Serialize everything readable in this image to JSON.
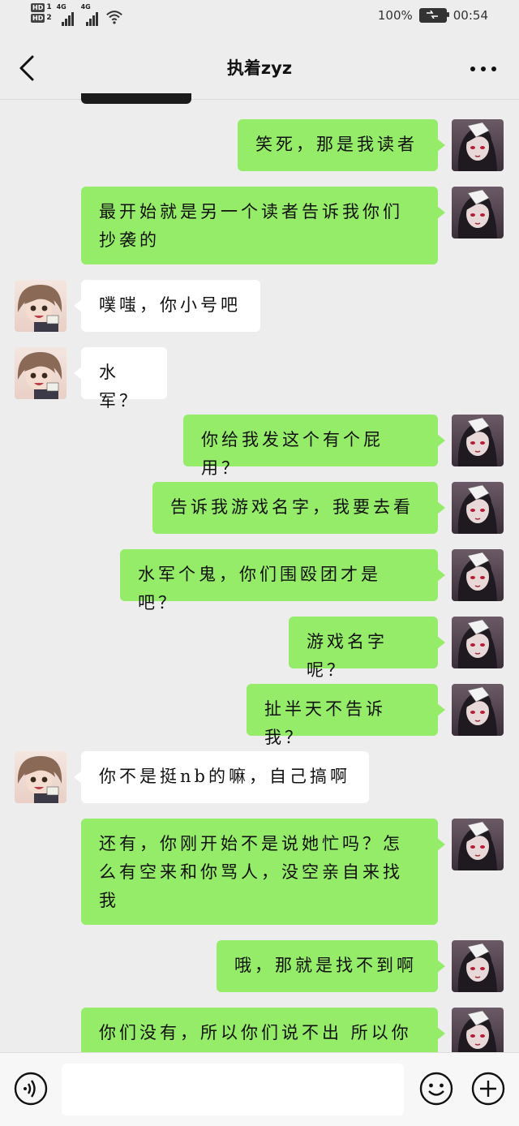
{
  "status_bar": {
    "sim1": "HD",
    "sim1_num": "1",
    "sim2": "HD",
    "sim2_num": "2",
    "net1": "4G",
    "net2": "4G",
    "battery_percent": "100%",
    "time": "00:54"
  },
  "header": {
    "title": "执着zyz"
  },
  "messages": [
    {
      "side": "right",
      "text": "笑死，那是我读者"
    },
    {
      "side": "right",
      "text": "最开始就是另一个读者告诉我你们抄袭的"
    },
    {
      "side": "left",
      "text": "噗嗤，你小号吧"
    },
    {
      "side": "left",
      "text": "水军？"
    },
    {
      "side": "right",
      "text": "你给我发这个有个屁用？"
    },
    {
      "side": "right",
      "text": "告诉我游戏名字，我要去看"
    },
    {
      "side": "right",
      "text": "水军个鬼，你们围殴团才是吧？"
    },
    {
      "side": "right",
      "text": "游戏名字呢？"
    },
    {
      "side": "right",
      "text": "扯半天不告诉我？"
    },
    {
      "side": "left",
      "text": "你不是挺nb的嘛，自己搞啊"
    },
    {
      "side": "right",
      "text": "还有，你刚开始不是说她忙吗？怎么有空来和你骂人，没空亲自来找我"
    },
    {
      "side": "right",
      "text": "哦，那就是找不到啊"
    },
    {
      "side": "right",
      "text": "你们没有，所以你们说不出 所以你们在..."
    }
  ],
  "colors": {
    "self_bubble": "#95ec69",
    "other_bubble": "#ffffff",
    "background": "#ededed"
  },
  "input": {
    "value": "",
    "placeholder": ""
  }
}
